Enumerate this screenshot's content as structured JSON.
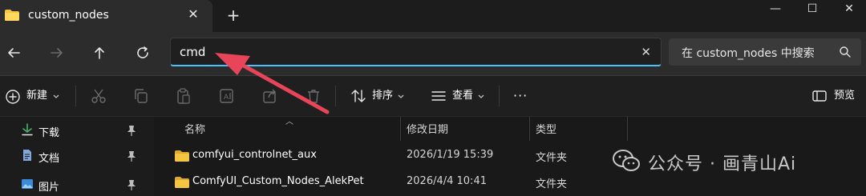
{
  "tab": {
    "title": "custom_nodes",
    "close_label": "✕",
    "new_tab_label": "+"
  },
  "window_controls": {
    "minimize": "—",
    "maximize": "☐",
    "close": "✕"
  },
  "address": {
    "value": "cmd",
    "clear_label": "✕"
  },
  "search": {
    "placeholder": "在 custom_nodes 中搜索"
  },
  "toolbar": {
    "new_label": "新建",
    "sort_label": "排序",
    "view_label": "查看",
    "more_label": "···",
    "preview_label": "预览"
  },
  "sidebar": {
    "items": [
      {
        "label": "下载",
        "icon": "download-icon"
      },
      {
        "label": "文档",
        "icon": "document-icon"
      },
      {
        "label": "图片",
        "icon": "picture-icon"
      }
    ]
  },
  "columns": {
    "name": "名称",
    "date": "修改日期",
    "type": "类型"
  },
  "files": [
    {
      "name": "comfyui_controlnet_aux",
      "date": "2026/1/19 15:39",
      "type": "文件夹"
    },
    {
      "name": "ComfyUI_Custom_Nodes_AlekPet",
      "date": "2026/4/4 10:41",
      "type": "文件夹"
    }
  ],
  "watermark": {
    "text": "公众号 · 画青山Ai"
  },
  "colors": {
    "accent": "#4cc2ff",
    "folder": "#f4c542",
    "annotation_arrow": "#e8455a"
  }
}
